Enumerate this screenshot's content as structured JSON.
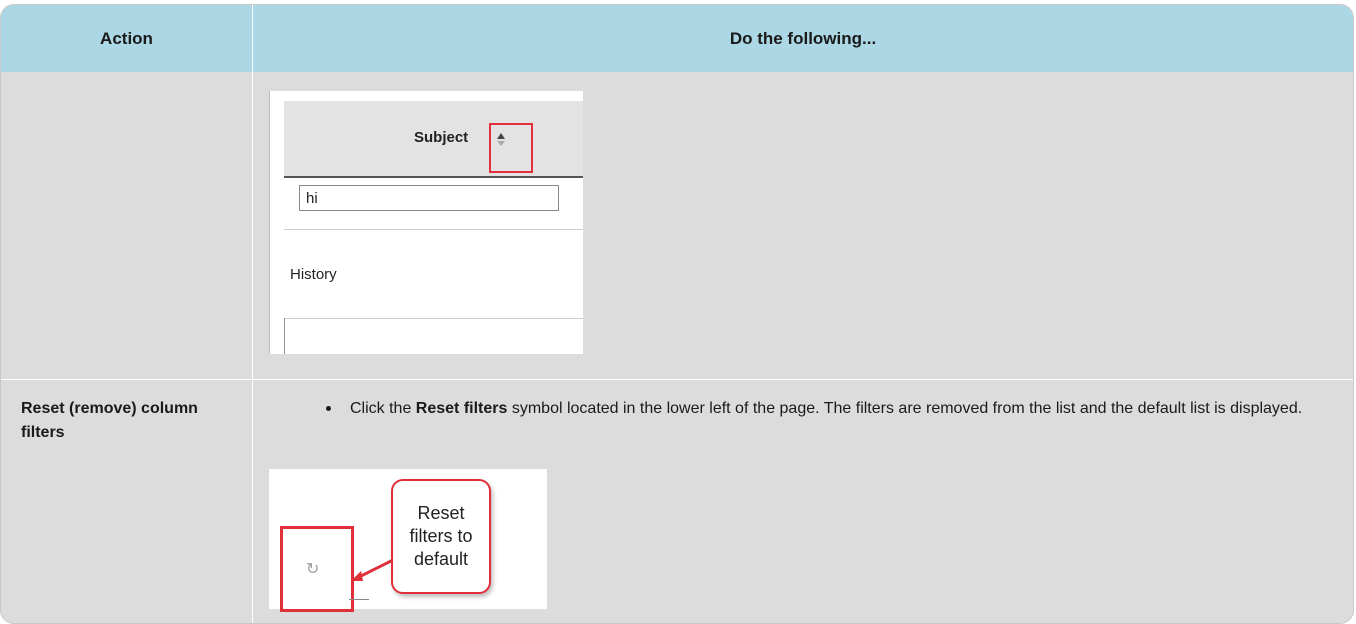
{
  "table": {
    "headers": {
      "action": "Action",
      "do": "Do the following..."
    }
  },
  "screenshot_sort": {
    "column_title": "Subject",
    "filter_value": "hi",
    "cell_value": "History"
  },
  "row_reset": {
    "action_label": "Reset (remove) column filters",
    "instruction_prefix": "Click the ",
    "instruction_bold": "Reset filters",
    "instruction_suffix": " symbol located in the lower left of the page. The filters are removed from the list and the default list is displayed."
  },
  "screenshot_reset": {
    "callout_text": "Reset\nfilters to\ndefault",
    "icon": "refresh-icon"
  },
  "colors": {
    "header_bg": "#acd7e5",
    "body_bg": "#dcdcdc",
    "highlight_red": "#e0303a"
  }
}
